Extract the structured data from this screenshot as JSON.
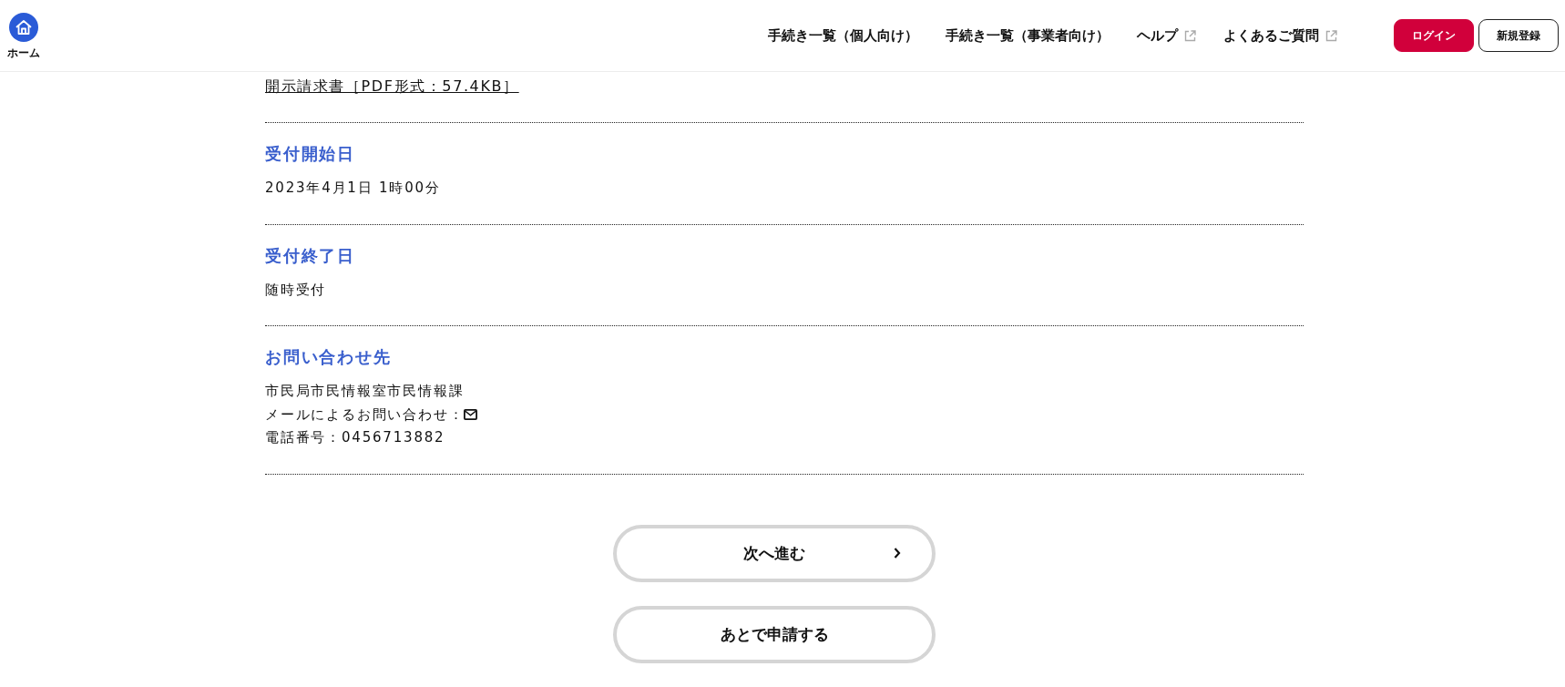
{
  "header": {
    "home": {
      "label": "ホーム"
    },
    "nav": [
      {
        "label": "手続き一覧（個人向け）",
        "external": false
      },
      {
        "label": "手続き一覧（事業者向け）",
        "external": false
      },
      {
        "label": "ヘルプ",
        "external": true
      },
      {
        "label": "よくあるご質問",
        "external": true
      }
    ],
    "buttons": [
      {
        "label": "ログイン",
        "kind": "login"
      },
      {
        "label": "新規登録",
        "kind": "register"
      }
    ]
  },
  "attachment": {
    "label": "開示請求書［PDF形式：57.4KB］"
  },
  "sections": [
    {
      "heading": "受付開始日",
      "lines": [
        {
          "text": "2023年4月1日 1時00分",
          "kind": "text"
        }
      ]
    },
    {
      "heading": "受付終了日",
      "lines": [
        {
          "text": "随時受付",
          "kind": "text"
        }
      ]
    },
    {
      "heading": "お問い合わせ先",
      "lines": [
        {
          "text": "市民局市民情報室市民情報課",
          "kind": "text"
        },
        {
          "text": "メールによるお問い合わせ：",
          "kind": "email"
        },
        {
          "text": "電話番号：0456713882",
          "kind": "text"
        }
      ]
    }
  ],
  "actions": [
    {
      "label": "次へ進む",
      "arrow": true
    },
    {
      "label": "あとで申請する",
      "arrow": false
    }
  ]
}
